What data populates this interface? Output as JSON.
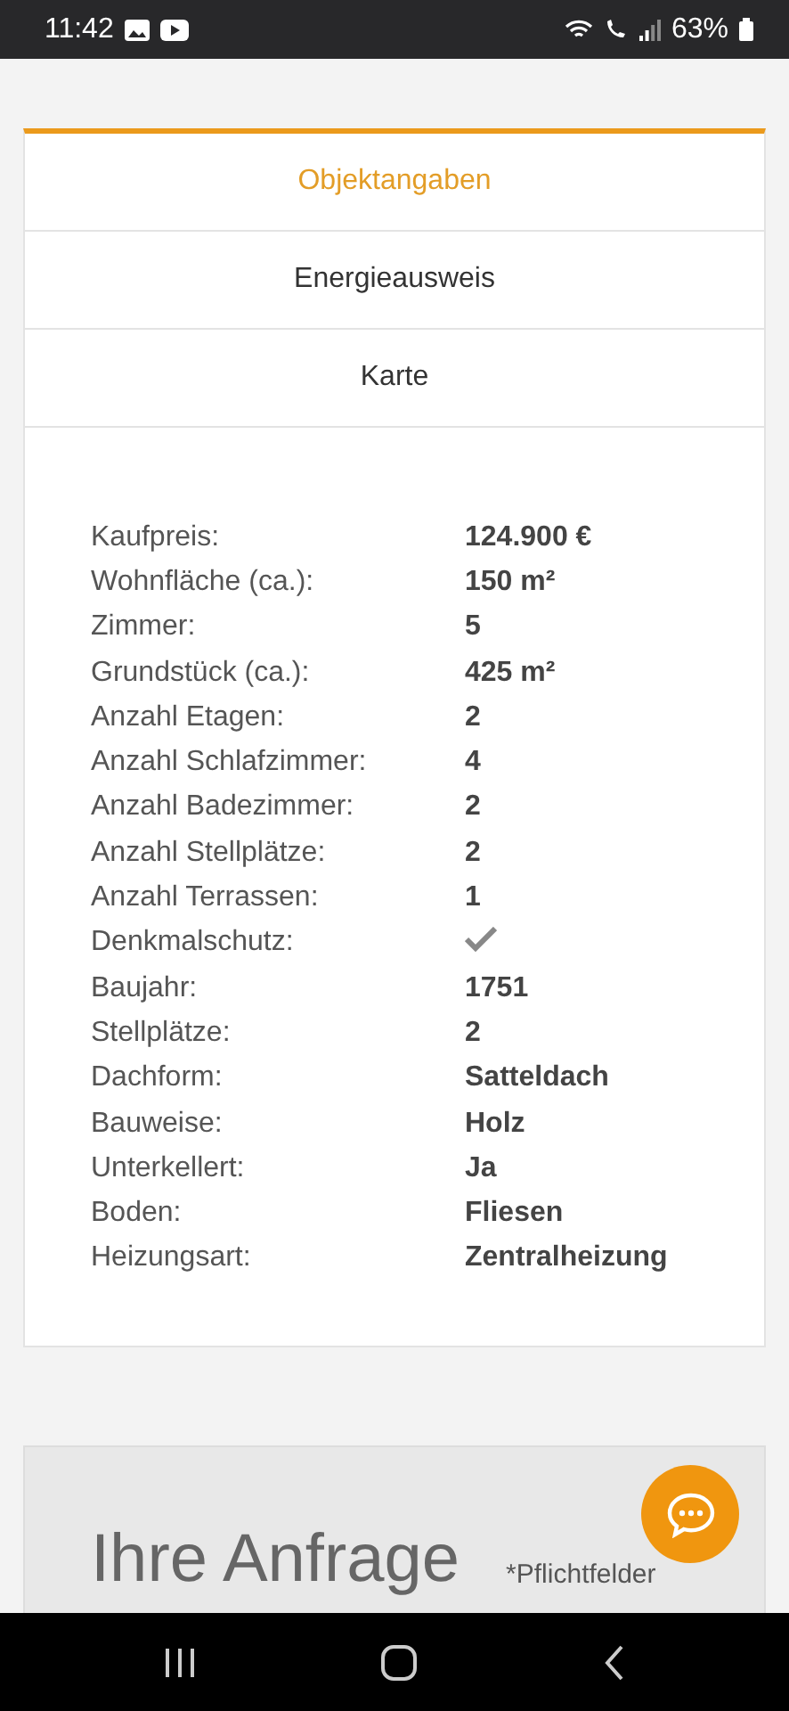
{
  "status_bar": {
    "time": "11:42",
    "battery": "63%"
  },
  "tabs": [
    {
      "label": "Objektangaben",
      "selected": true
    },
    {
      "label": "Energieausweis",
      "selected": false
    },
    {
      "label": "Karte",
      "selected": false
    }
  ],
  "details": [
    {
      "label": "Kaufpreis:",
      "kind": "text",
      "value": "124.900 €"
    },
    {
      "label": "Wohnfläche (ca.):",
      "kind": "text",
      "value": "150 m²"
    },
    {
      "label": "Zimmer:",
      "kind": "text",
      "value": "5"
    },
    {
      "label": "Grundstück (ca.):",
      "kind": "text",
      "value": "425 m²"
    },
    {
      "label": "Anzahl Etagen:",
      "kind": "text",
      "value": "2"
    },
    {
      "label": "Anzahl Schlafzimmer:",
      "kind": "text",
      "value": "4"
    },
    {
      "label": "Anzahl Badezimmer:",
      "kind": "text",
      "value": "2"
    },
    {
      "label": "Anzahl Stellplätze:",
      "kind": "text",
      "value": "2"
    },
    {
      "label": "Anzahl Terrassen:",
      "kind": "text",
      "value": "1"
    },
    {
      "label": "Denkmalschutz:",
      "kind": "check",
      "checked": true
    },
    {
      "label": "Baujahr:",
      "kind": "text",
      "value": "1751"
    },
    {
      "label": "Stellplätze:",
      "kind": "text",
      "value": "2"
    },
    {
      "label": "Dachform:",
      "kind": "text",
      "value": "Satteldach"
    },
    {
      "label": "Bauweise:",
      "kind": "text",
      "value": "Holz"
    },
    {
      "label": "Unterkellert:",
      "kind": "text",
      "value": "Ja"
    },
    {
      "label": "Boden:",
      "kind": "text",
      "value": "Fliesen"
    },
    {
      "label": "Heizungsart:",
      "kind": "text",
      "value": "Zentralheizung"
    }
  ],
  "form": {
    "title": "Ihre Anfrage",
    "required_note": "*Pflichtfelder"
  }
}
